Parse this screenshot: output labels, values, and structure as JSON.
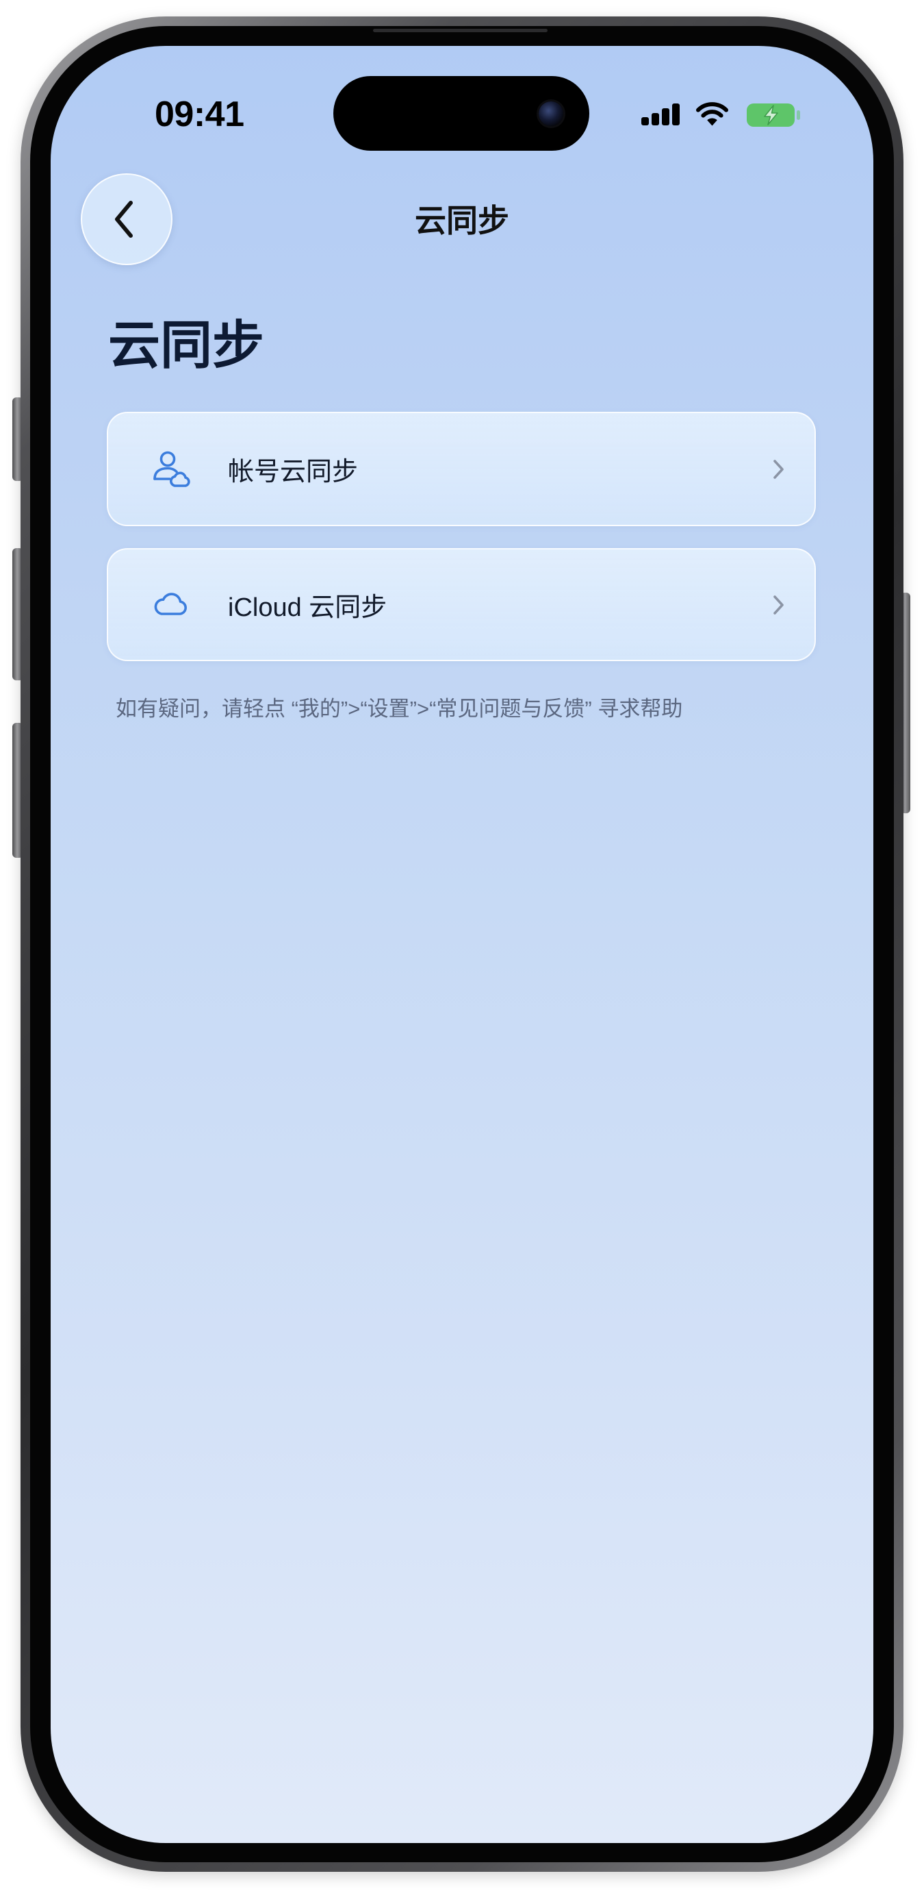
{
  "status_bar": {
    "time": "09:41",
    "icons": [
      "cellular-signal-icon",
      "wifi-icon",
      "battery-charging-icon"
    ]
  },
  "nav": {
    "back_icon": "chevron-left-icon",
    "title": "云同步"
  },
  "page": {
    "title": "云同步"
  },
  "sync_options": [
    {
      "icon": "account-cloud-icon",
      "label": "帐号云同步"
    },
    {
      "icon": "cloud-icon",
      "label": "iCloud 云同步"
    }
  ],
  "help_text": "如有疑问，请轻点 “我的”>“设置”>“常见问题与反馈” 寻求帮助",
  "colors": {
    "accent": "#3b7ddd",
    "title": "#0d1a33",
    "text": "#121a2a",
    "muted": "#5b6780",
    "chevron": "#8b94a5",
    "battery": "#5ec569",
    "background_top": "#b1cbf4",
    "background_bottom": "#e1eaf9"
  }
}
